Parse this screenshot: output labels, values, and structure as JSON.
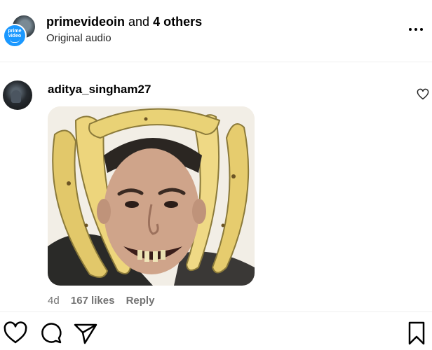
{
  "header": {
    "username": "primevideoin",
    "joiner": " and ",
    "others": "4 others",
    "subtitle": "Original audio",
    "avatar_logo_line1": "prime",
    "avatar_logo_line2": "video"
  },
  "comment": {
    "username": "aditya_singham27",
    "age": "4d",
    "likes": "167 likes",
    "reply_label": "Reply"
  },
  "icons": {
    "more": "more-horizontal-icon",
    "comment_like": "heart-outline-icon",
    "like": "heart-icon",
    "comment": "comment-bubble-icon",
    "share": "paper-plane-icon",
    "save": "bookmark-icon"
  },
  "colors": {
    "accent": "#1a98ff",
    "muted_text": "#737373",
    "divider": "#efefef"
  }
}
